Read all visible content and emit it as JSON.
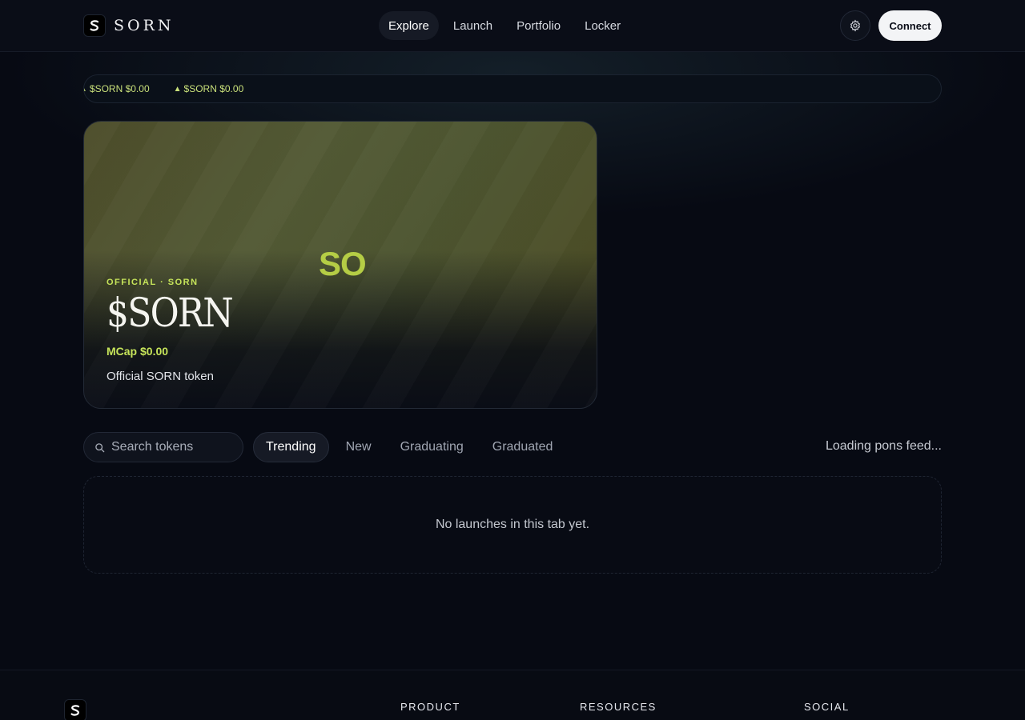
{
  "header": {
    "brand_name": "SORN",
    "logo_icon": "sorn-s-logo",
    "nav": [
      {
        "label": "Explore",
        "active": true
      },
      {
        "label": "Launch",
        "active": false
      },
      {
        "label": "Portfolio",
        "active": false
      },
      {
        "label": "Locker",
        "active": false
      }
    ],
    "settings_icon": "gear-icon",
    "connect_label": "Connect"
  },
  "ticker": {
    "items": [
      {
        "icon": "triangle-up-icon",
        "text": "$SORN $0.00"
      },
      {
        "icon": "triangle-up-icon",
        "text": "$SORN $0.00"
      }
    ]
  },
  "featured": {
    "monogram": "SO",
    "badge": "OFFICIAL · SORN",
    "title": "$SORN",
    "mcap": "MCap $0.00",
    "description": "Official SORN token"
  },
  "toolbar": {
    "search_placeholder": "Search tokens",
    "tabs": [
      {
        "label": "Trending",
        "active": true
      },
      {
        "label": "New",
        "active": false
      },
      {
        "label": "Graduating",
        "active": false
      },
      {
        "label": "Graduated",
        "active": false
      }
    ],
    "feed_status": "Loading pons feed..."
  },
  "list": {
    "empty_message": "No launches in this tab yet."
  },
  "footer": {
    "columns": [
      "PRODUCT",
      "RESOURCES",
      "SOCIAL"
    ]
  },
  "colors": {
    "background": "#070a13",
    "accent": "#c6e45a",
    "connect_bg": "#f3f4f6"
  }
}
